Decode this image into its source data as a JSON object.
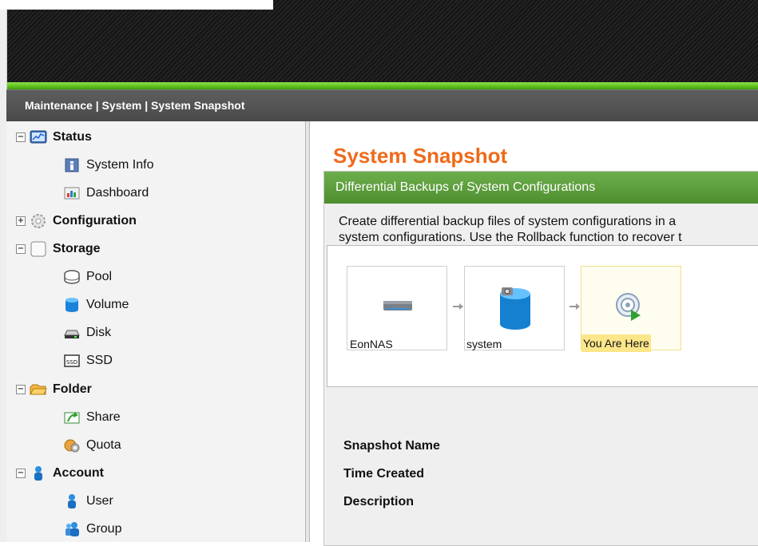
{
  "breadcrumb": "Maintenance | System | System Snapshot",
  "sidebar": {
    "items": [
      {
        "label": "Status",
        "icon": "status-chart-icon",
        "level": 0,
        "toggle": "−"
      },
      {
        "label": "System Info",
        "icon": "system-info-icon",
        "level": 1
      },
      {
        "label": "Dashboard",
        "icon": "dashboard-icon",
        "level": 1
      },
      {
        "label": "Configuration",
        "icon": "gear-icon",
        "level": 0,
        "toggle": "+"
      },
      {
        "label": "Storage",
        "icon": "storage-icon",
        "level": 0,
        "toggle": "−"
      },
      {
        "label": "Pool",
        "icon": "pool-icon",
        "level": 1
      },
      {
        "label": "Volume",
        "icon": "volume-icon",
        "level": 1
      },
      {
        "label": "Disk",
        "icon": "disk-icon",
        "level": 1
      },
      {
        "label": "SSD",
        "icon": "ssd-icon",
        "level": 1
      },
      {
        "label": "Folder",
        "icon": "folder-icon",
        "level": 0,
        "toggle": "−"
      },
      {
        "label": "Share",
        "icon": "share-icon",
        "level": 1
      },
      {
        "label": "Quota",
        "icon": "quota-icon",
        "level": 1
      },
      {
        "label": "Account",
        "icon": "account-icon",
        "level": 0,
        "toggle": "−"
      },
      {
        "label": "User",
        "icon": "user-icon",
        "level": 1
      },
      {
        "label": "Group",
        "icon": "group-icon",
        "level": 1
      }
    ]
  },
  "main": {
    "title": "System Snapshot",
    "panel_header": "Differential Backups of System Configurations",
    "description_line1": "Create differential backup files of system configurations in a",
    "description_line2": "system configurations. Use the Rollback function to recover t",
    "nodes": [
      {
        "label": "EonNAS",
        "icon": "nas-device-icon"
      },
      {
        "label": "system",
        "icon": "system-volume-icon"
      },
      {
        "label": "You Are Here",
        "icon": "current-position-icon"
      }
    ],
    "properties": [
      {
        "label": "Snapshot Name"
      },
      {
        "label": "Time Created"
      },
      {
        "label": "Description"
      }
    ]
  },
  "colors": {
    "accent_orange": "#ef6a1a",
    "header_green": "#5c9e3b",
    "highlight_yellow": "#fce68a",
    "top_bar_green": "#5cbf1c"
  }
}
